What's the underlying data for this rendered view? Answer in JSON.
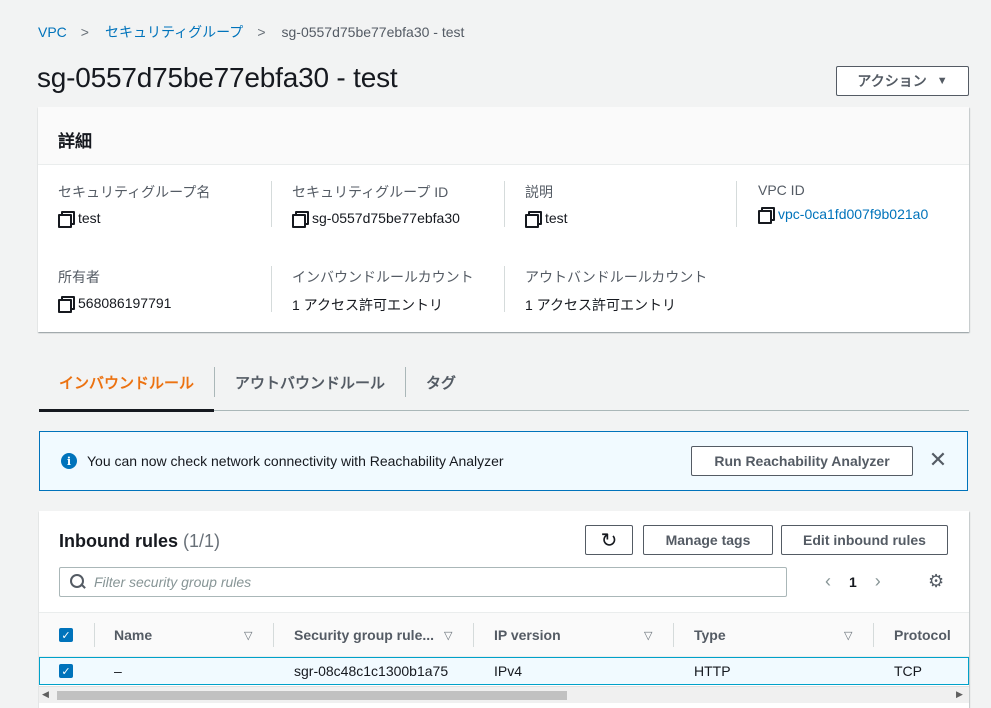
{
  "breadcrumb": {
    "vpc": "VPC",
    "security_groups": "セキュリティグループ",
    "current": "sg-0557d75be77ebfa30 - test"
  },
  "page": {
    "title": "sg-0557d75be77ebfa30 - test",
    "actions_label": "アクション"
  },
  "details": {
    "heading": "詳細",
    "sg_name_label": "セキュリティグループ名",
    "sg_name_value": "test",
    "sg_id_label": "セキュリティグループ ID",
    "sg_id_value": "sg-0557d75be77ebfa30",
    "description_label": "説明",
    "description_value": "test",
    "vpc_id_label": "VPC ID",
    "vpc_id_value": "vpc-0ca1fd007f9b021a0",
    "owner_label": "所有者",
    "owner_value": "568086197791",
    "inbound_count_label": "インバウンドルールカウント",
    "inbound_count_value": "1 アクセス許可エントリ",
    "outbound_count_label": "アウトバンドルールカウント",
    "outbound_count_value": "1 アクセス許可エントリ"
  },
  "tabs": [
    {
      "label": "インバウンドルール",
      "active": true
    },
    {
      "label": "アウトバウンドルール",
      "active": false
    },
    {
      "label": "タグ",
      "active": false
    }
  ],
  "flash": {
    "info_glyph": "i",
    "message": "You can now check network connectivity with Reachability Analyzer",
    "button": "Run Reachability Analyzer",
    "close_glyph": "✕"
  },
  "rules": {
    "title": "Inbound rules",
    "count": "(1/1)",
    "manage_tags": "Manage tags",
    "edit_inbound": "Edit inbound rules",
    "search_placeholder": "Filter security group rules",
    "page_number": "1",
    "columns": [
      "Name",
      "Security group rule...",
      "IP version",
      "Type",
      "Protocol"
    ],
    "rows": [
      {
        "name": "–",
        "rule_id": "sgr-08c48c1c1300b1a75",
        "ip_version": "IPv4",
        "type": "HTTP",
        "protocol": "TCP"
      }
    ]
  },
  "colors": {
    "link": "#0073bb",
    "active_tab": "#ec7211",
    "info_bg": "#f1faff",
    "info_border": "#0073bb"
  },
  "icons": {
    "copy": "copy-icon",
    "refresh": "refresh-icon",
    "search": "search-icon",
    "settings": "gear-icon",
    "info": "info-icon",
    "close": "close-icon"
  }
}
